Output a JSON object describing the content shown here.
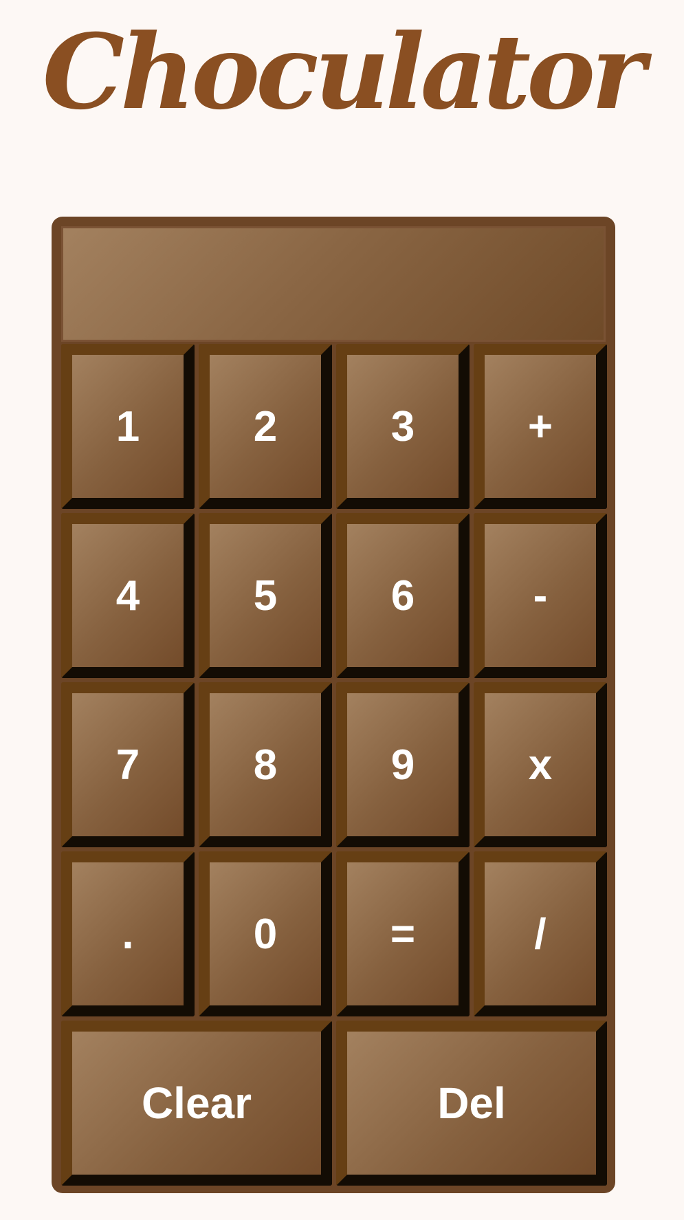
{
  "app": {
    "title": "Choculator"
  },
  "display": {
    "value": ""
  },
  "keys": {
    "one": "1",
    "two": "2",
    "three": "3",
    "plus": "+",
    "four": "4",
    "five": "5",
    "six": "6",
    "minus": "-",
    "seven": "7",
    "eight": "8",
    "nine": "9",
    "multiply": "x",
    "decimal": ".",
    "zero": "0",
    "equals": "=",
    "divide": "/",
    "clear": "Clear",
    "delete": "Del"
  },
  "colors": {
    "background": "#fdf8f5",
    "title": "#8a4f22",
    "body": "#6c4526",
    "key_light": "#a3815f",
    "key_dark": "#734b2a",
    "key_shadow": "#130c04",
    "key_edge": "#663f14",
    "text": "#ffffff"
  }
}
